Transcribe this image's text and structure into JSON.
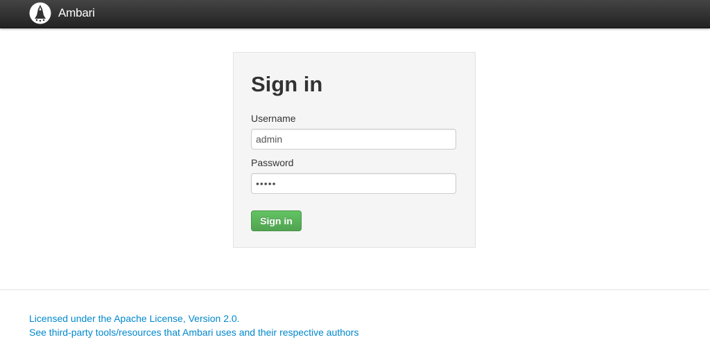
{
  "header": {
    "brand_name": "Ambari",
    "logo_icon": "ambari-logo-icon"
  },
  "login": {
    "title": "Sign in",
    "username_label": "Username",
    "username_value": "admin",
    "password_label": "Password",
    "password_value": "•••••",
    "signin_button_label": "Sign in"
  },
  "footer": {
    "license_link": "Licensed under the Apache License, Version 2.0.",
    "thirdparty_link": "See third-party tools/resources that Ambari uses and their respective authors"
  },
  "colors": {
    "topbar": "#333333",
    "button_green": "#5bb75b",
    "link_blue": "#0088cc",
    "panel_bg": "#f5f5f5"
  }
}
